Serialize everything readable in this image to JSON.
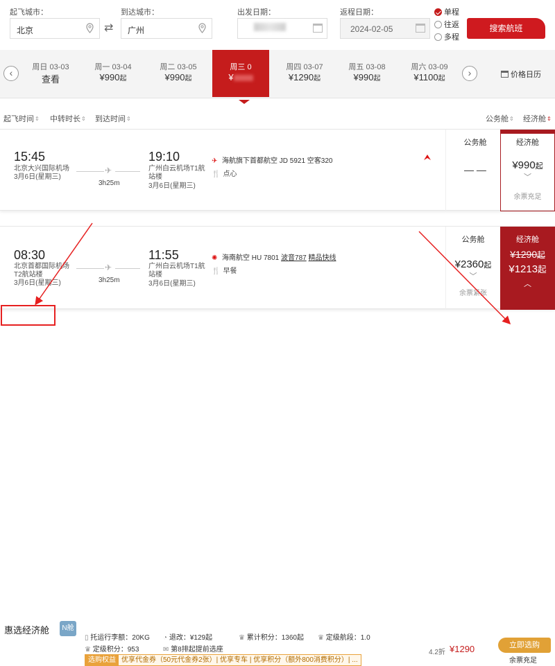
{
  "search": {
    "from_label": "起飞城市：",
    "from_value": "北京",
    "to_label": "到达城市：",
    "to_value": "广州",
    "depart_label": "出发日期：",
    "return_label": "返程日期：",
    "return_value": "2024-02-05",
    "trip_options": [
      "单程",
      "往返",
      "多程"
    ],
    "search_button": "搜索航班"
  },
  "dates": {
    "days": [
      {
        "d1": "周日 03-03",
        "d2": "查看",
        "suffix": ""
      },
      {
        "d1": "周一 03-04",
        "d2": "¥990",
        "suffix": "起"
      },
      {
        "d1": "周二 03-05",
        "d2": "¥990",
        "suffix": "起"
      },
      {
        "d1": "周三 0",
        "d2": "¥",
        "suffix": ""
      },
      {
        "d1": "周四 03-07",
        "d2": "¥1290",
        "suffix": "起"
      },
      {
        "d1": "周五 03-08",
        "d2": "¥990",
        "suffix": "起"
      },
      {
        "d1": "周六 03-09",
        "d2": "¥1100",
        "suffix": "起"
      }
    ],
    "calendar_link": "价格日历"
  },
  "sort": {
    "depart_time": "起飞时间",
    "transfer": "中转时长",
    "arrive_time": "到达时间",
    "business": "公务舱",
    "economy": "经济舱"
  },
  "flights": [
    {
      "dep_time": "15:45",
      "dep_airport": "北京大兴国际机场",
      "dep_date": "3月6日(星期三)",
      "duration": "3h25m",
      "arr_time": "19:10",
      "arr_airport_1": "广州白云机场T1航",
      "arr_airport_2": "站楼",
      "arr_date": "3月6日(星期三)",
      "airline": "海航旗下首都航空 JD 5921 空客320",
      "meal": "点心",
      "business_title": "公务舱",
      "business_price": "— —",
      "economy_title": "经济舱",
      "economy_price": "¥990",
      "economy_suffix": "起",
      "economy_note": "余票充足"
    },
    {
      "dep_time": "08:30",
      "dep_airport_1": "北京首都国际机场",
      "dep_airport_2": "T2航站楼",
      "dep_date": "3月6日(星期三)",
      "duration": "3h25m",
      "arr_time": "11:55",
      "arr_airport_1": "广州白云机场T1航",
      "arr_airport_2": "站楼",
      "arr_date": "3月6日(星期三)",
      "airline_prefix": "海南航空 HU 7801",
      "aircraft": "波音787",
      "tag": "精品快线",
      "meal": "早餐",
      "business_title": "公务舱",
      "business_price": "¥2360",
      "business_suffix": "起",
      "business_note": "余票紧张",
      "economy_title": "经济舱",
      "economy_old": "¥1290",
      "economy_new": "¥1213",
      "economy_suffix": "起"
    }
  ],
  "bottom": {
    "product": "惠选经济舱",
    "product_badge": "N舱",
    "baggage": "托运行李额：20KG",
    "refund": "退改：¥129起",
    "points": "累计积分：1360起",
    "segment": "定级航段：1.0",
    "grade_points": "定级积分：953",
    "seat": "第8排起提前选座",
    "promo_tag": "选购权益",
    "promo_text": "优享代金券（50元代金券2张）| 优享专车 | 优享积分（额外800消费积分）| ...",
    "discount": "4.2折",
    "price": "¥1290",
    "book_button": "立即选购",
    "stock": "余票充足"
  },
  "colors": {
    "accent": "#c51c1c",
    "dark_red": "#a81a20",
    "gold": "#e1a136"
  }
}
